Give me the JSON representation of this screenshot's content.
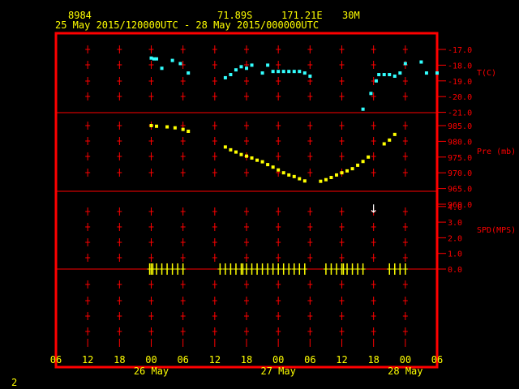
{
  "header": {
    "station_id": "8984",
    "latitude": "71.89S",
    "longitude": "171.21E",
    "elevation": "30M",
    "time_range": "25 May 2015/120000UTC - 28 May 2015/000000UTC"
  },
  "footer": {
    "page_number": "2"
  },
  "colors": {
    "background": "#000000",
    "frame": "#ff0000",
    "axis_text": "#ffff00",
    "label_text": "#ff0000",
    "temperature": "#33ffff",
    "pressure": "#ffff00",
    "wind": "#ffff00",
    "arrow": "#ffffff"
  },
  "chart_data": {
    "type": "scatter",
    "x_axis": {
      "range_hours": [
        -6,
        66
      ],
      "tick_labels": [
        "06",
        "12",
        "18",
        "00",
        "06",
        "12",
        "18",
        "00",
        "06",
        "12",
        "18",
        "00",
        "06"
      ],
      "date_labels": [
        {
          "text": "26 May",
          "hour": 12
        },
        {
          "text": "27 May",
          "hour": 36
        },
        {
          "text": "28 May",
          "hour": 60
        }
      ]
    },
    "panels": [
      {
        "name": "temperature",
        "ylabel": "T(C)",
        "ylim": [
          -21.0,
          -16.5
        ],
        "ticks": [
          "-17.0",
          "-18.0",
          "-19.0",
          "-20.0",
          "-21.0"
        ],
        "tick_values": [
          -17,
          -18,
          -19,
          -20,
          -21
        ],
        "points": [
          [
            12,
            -17.55
          ],
          [
            12.5,
            -17.6
          ],
          [
            13,
            -17.6
          ],
          [
            14,
            -18.2
          ],
          [
            16,
            -17.7
          ],
          [
            17.5,
            -17.9
          ],
          [
            19,
            -18.5
          ],
          [
            26,
            -18.8
          ],
          [
            27,
            -18.6
          ],
          [
            28,
            -18.3
          ],
          [
            29,
            -18.1
          ],
          [
            30,
            -18.2
          ],
          [
            31,
            -18.0
          ],
          [
            33,
            -18.5
          ],
          [
            34,
            -18.0
          ],
          [
            35,
            -18.4
          ],
          [
            36,
            -18.4
          ],
          [
            37,
            -18.4
          ],
          [
            38,
            -18.4
          ],
          [
            39,
            -18.4
          ],
          [
            40,
            -18.4
          ],
          [
            41,
            -18.5
          ],
          [
            42,
            -18.7
          ],
          [
            52,
            -20.8
          ],
          [
            53.5,
            -19.8
          ],
          [
            54.5,
            -19.0
          ],
          [
            55,
            -18.6
          ],
          [
            56,
            -18.6
          ],
          [
            57,
            -18.6
          ],
          [
            58,
            -18.7
          ],
          [
            59,
            -18.5
          ],
          [
            60,
            -17.9
          ],
          [
            63,
            -17.8
          ],
          [
            64,
            -18.5
          ],
          [
            66,
            -18.5
          ]
        ]
      },
      {
        "name": "pressure",
        "ylabel": "Pre (mb)",
        "ylim": [
          960.0,
          986.0
        ],
        "ticks": [
          "985.0",
          "980.0",
          "975.0",
          "970.0",
          "965.0",
          "960.0"
        ],
        "tick_values": [
          985,
          980,
          975,
          970,
          965,
          960
        ],
        "points": [
          [
            12,
            985.0
          ],
          [
            13,
            984.8
          ],
          [
            15,
            984.6
          ],
          [
            16.5,
            984.3
          ],
          [
            18,
            983.8
          ],
          [
            19,
            983.2
          ],
          [
            26,
            978.2
          ],
          [
            27,
            977.3
          ],
          [
            28,
            976.6
          ],
          [
            29,
            975.8
          ],
          [
            30,
            975.3
          ],
          [
            31,
            974.7
          ],
          [
            32,
            974.0
          ],
          [
            33,
            973.5
          ],
          [
            34,
            972.6
          ],
          [
            35,
            971.8
          ],
          [
            36,
            970.9
          ],
          [
            37,
            970.0
          ],
          [
            38,
            969.3
          ],
          [
            39,
            968.8
          ],
          [
            40,
            968.1
          ],
          [
            41,
            967.4
          ],
          [
            44,
            967.3
          ],
          [
            45,
            967.8
          ],
          [
            46,
            968.5
          ],
          [
            47,
            969.3
          ],
          [
            48,
            970.0
          ],
          [
            49,
            970.6
          ],
          [
            50,
            971.3
          ],
          [
            51,
            972.4
          ],
          [
            52,
            973.6
          ],
          [
            53,
            975.0
          ],
          [
            56,
            979.2
          ],
          [
            57,
            980.4
          ],
          [
            58,
            982.2
          ]
        ]
      },
      {
        "name": "wind",
        "ylabel": "SPD(MPS)",
        "ylim": [
          -0.2,
          4.5
        ],
        "ticks": [
          "4.0",
          "3.0",
          "2.0",
          "1.0",
          "0.0"
        ],
        "tick_values": [
          4,
          3,
          2,
          1,
          0
        ],
        "barbs": [
          11.7,
          12,
          12.3,
          13,
          14,
          15,
          16,
          17,
          18,
          25,
          26,
          27,
          28,
          29,
          29.3,
          30,
          31,
          32,
          33,
          34,
          35,
          36,
          37,
          38,
          39,
          40,
          41,
          45,
          46,
          47,
          48,
          48.3,
          49,
          50,
          51,
          52,
          57,
          58,
          59,
          60
        ],
        "arrows": [
          {
            "hour": 54,
            "speed": 3.9,
            "symbol": "↓"
          }
        ]
      }
    ],
    "grid": true
  }
}
